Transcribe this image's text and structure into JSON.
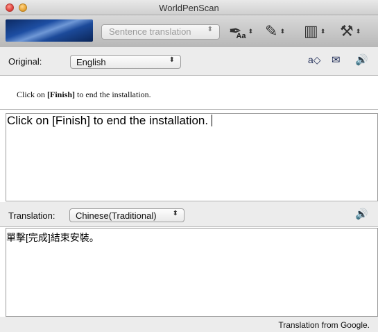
{
  "window": {
    "title": "WorldPenScan"
  },
  "toolbar": {
    "mode": "Sentence translation",
    "tools": [
      {
        "icon": "pen-font-icon",
        "suffix": "Aa"
      },
      {
        "icon": "pen-scan-icon"
      },
      {
        "icon": "pen-barcode-icon"
      },
      {
        "icon": "hammer-settings-icon"
      }
    ]
  },
  "original": {
    "label": "Original:",
    "language": "English",
    "scanned_text_prefix": "Click on ",
    "scanned_text_bold": "[Finish]",
    "scanned_text_suffix": " to end the installation.",
    "text": "Click on [Finish] to end the installation."
  },
  "translation": {
    "label": "Translation:",
    "language": "Chinese(Traditional)",
    "text": "單擊[完成]結束安裝。"
  },
  "footer": {
    "credit": "Translation from Google."
  }
}
